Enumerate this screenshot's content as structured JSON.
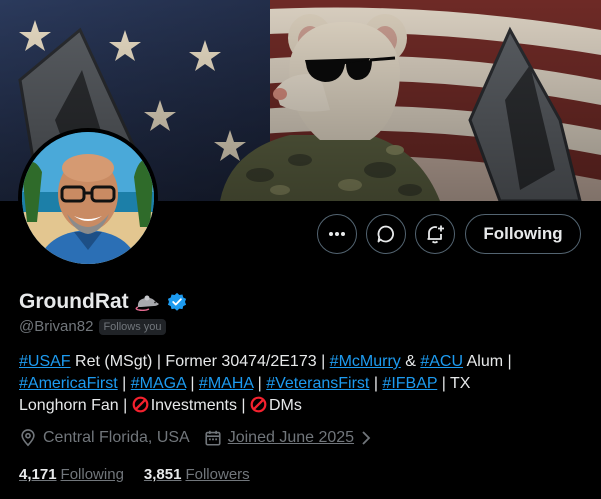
{
  "profile": {
    "display_name": "GroundRat",
    "handle": "@Brivan82",
    "follows_you": "Follows you",
    "follow_button": "Following"
  },
  "bio": {
    "line1": [
      {
        "text": "#USAF",
        "tag": true
      },
      {
        "text": " Ret (MSgt) | Former 30474/2E173 | ",
        "tag": false
      },
      {
        "text": "#McMurry",
        "tag": true
      },
      {
        "text": " & ",
        "tag": false
      },
      {
        "text": "#ACU",
        "tag": true
      },
      {
        "text": " Alum |",
        "tag": false
      }
    ],
    "line2": [
      {
        "text": "#AmericaFirst",
        "tag": true
      },
      {
        "text": " | ",
        "tag": false
      },
      {
        "text": "#MAGA",
        "tag": true
      },
      {
        "text": " | ",
        "tag": false
      },
      {
        "text": "#MAHA",
        "tag": true
      },
      {
        "text": " | ",
        "tag": false
      },
      {
        "text": "#VeteransFirst",
        "tag": true
      },
      {
        "text": " | ",
        "tag": false
      },
      {
        "text": "#IFBAP",
        "tag": true
      },
      {
        "text": " | TX",
        "tag": false
      }
    ],
    "line3_prefix": "Longhorn Fan | ",
    "investments": "Investments",
    "separator": " | ",
    "dms": "DMs"
  },
  "meta": {
    "location": "Central Florida, USA",
    "joined": "Joined June 2025"
  },
  "stats": {
    "following_count": "4,171",
    "following_label": "Following",
    "followers_count": "3,851",
    "followers_label": "Followers"
  },
  "icons": {
    "more": "more-dots-icon",
    "message": "message-bubble-icon",
    "notify": "bell-plus-icon",
    "verified": "verified-badge-icon",
    "rat": "rat-emoji-icon",
    "location": "location-pin-icon",
    "calendar": "calendar-icon",
    "chevron": "chevron-right-icon",
    "prohibited": "prohibited-icon"
  },
  "colors": {
    "accent": "#1d9bf0",
    "verified": "#1d9bf0",
    "muted": "#71767b",
    "text": "#e7e9ea",
    "background": "#000000",
    "prohibited": "#f4212e"
  }
}
